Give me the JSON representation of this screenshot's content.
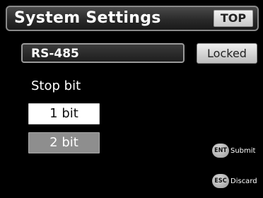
{
  "header": {
    "title": "System Settings",
    "top_button": "TOP"
  },
  "field": {
    "label": "RS-485",
    "status_button": "Locked"
  },
  "stop_bit": {
    "label": "Stop bit",
    "options": [
      {
        "label": "1 bit",
        "selected": true
      },
      {
        "label": "2 bit",
        "selected": false
      }
    ]
  },
  "keys": {
    "enter": {
      "badge": "ENT",
      "label": "Submit"
    },
    "escape": {
      "badge": "ESC",
      "label": "Discard"
    }
  },
  "colors": {
    "background": "#000000",
    "selected_option": "#ffffff",
    "unselected_option": "#8e8e8e"
  }
}
